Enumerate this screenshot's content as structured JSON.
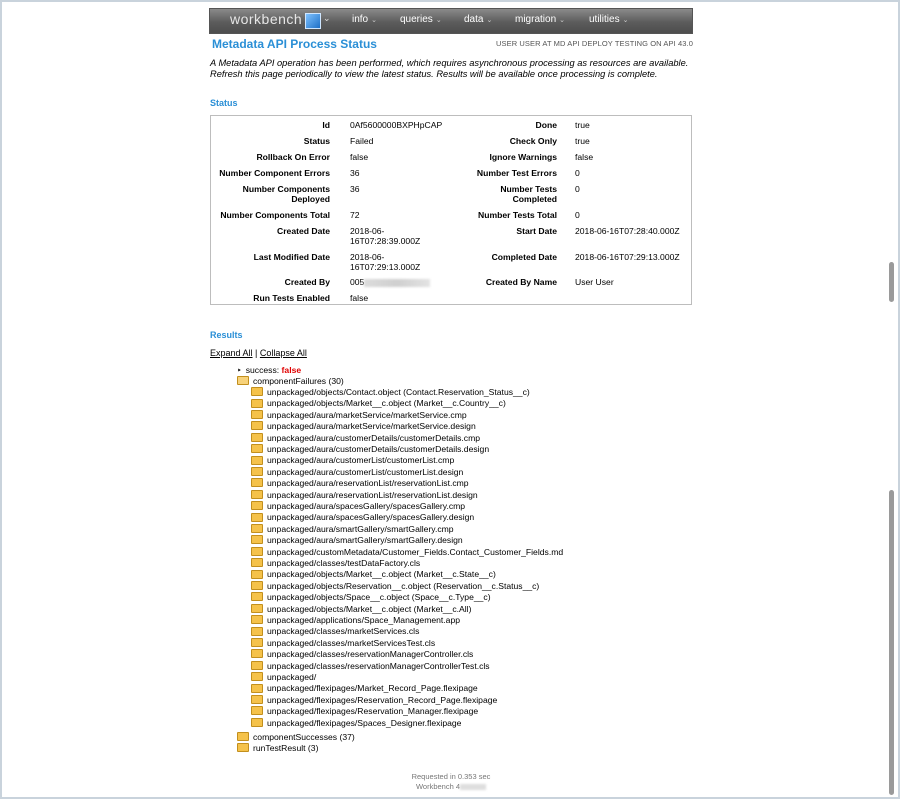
{
  "nav": {
    "brand": "workbench",
    "items": [
      {
        "label": "info"
      },
      {
        "label": "queries"
      },
      {
        "label": "data"
      },
      {
        "label": "migration"
      },
      {
        "label": "utilities"
      }
    ]
  },
  "header": {
    "title": "Metadata API Process Status",
    "user_info": "USER USER AT MD API DEPLOY TESTING ON API 43.0"
  },
  "intro": "A Metadata API operation has been performed, which requires asynchronous processing as resources are available. Refresh this page periodically to view the latest status. Results will be available once processing is complete.",
  "status": {
    "heading": "Status",
    "left": [
      {
        "label": "Id",
        "value": "0Af5600000BXPHpCAP"
      },
      {
        "label": "Status",
        "value": "Failed"
      },
      {
        "label": "Rollback On Error",
        "value": "false"
      },
      {
        "label": "Number Component Errors",
        "value": "36"
      },
      {
        "label": "Number Components Deployed",
        "value": "36"
      },
      {
        "label": "Number Components Total",
        "value": "72"
      },
      {
        "label": "Created Date",
        "value": "2018-06-16T07:28:39.000Z"
      },
      {
        "label": "Last Modified Date",
        "value": "2018-06-16T07:29:13.000Z"
      },
      {
        "label": "Created By",
        "value": "005"
      },
      {
        "label": "Run Tests Enabled",
        "value": "false"
      }
    ],
    "right": [
      {
        "label": "Done",
        "value": "true"
      },
      {
        "label": "Check Only",
        "value": "true"
      },
      {
        "label": "Ignore Warnings",
        "value": "false"
      },
      {
        "label": "Number Test Errors",
        "value": "0"
      },
      {
        "label": "Number Tests Completed",
        "value": "0"
      },
      {
        "label": "Number Tests Total",
        "value": "0"
      },
      {
        "label": "Start Date",
        "value": "2018-06-16T07:28:40.000Z"
      },
      {
        "label": "Completed Date",
        "value": "2018-06-16T07:29:13.000Z"
      },
      {
        "label": "Created By Name",
        "value": "User User"
      }
    ]
  },
  "results": {
    "heading": "Results",
    "expand_all": "Expand All",
    "separator": "|",
    "collapse_all": "Collapse All",
    "success_label": "success:",
    "success_value": "false",
    "component_failures": "componentFailures (30)",
    "failures": [
      "unpackaged/objects/Contact.object (Contact.Reservation_Status__c)",
      "unpackaged/objects/Market__c.object (Market__c.Country__c)",
      "unpackaged/aura/marketService/marketService.cmp",
      "unpackaged/aura/marketService/marketService.design",
      "unpackaged/aura/customerDetails/customerDetails.cmp",
      "unpackaged/aura/customerDetails/customerDetails.design",
      "unpackaged/aura/customerList/customerList.cmp",
      "unpackaged/aura/customerList/customerList.design",
      "unpackaged/aura/reservationList/reservationList.cmp",
      "unpackaged/aura/reservationList/reservationList.design",
      "unpackaged/aura/spacesGallery/spacesGallery.cmp",
      "unpackaged/aura/spacesGallery/spacesGallery.design",
      "unpackaged/aura/smartGallery/smartGallery.cmp",
      "unpackaged/aura/smartGallery/smartGallery.design",
      "unpackaged/customMetadata/Customer_Fields.Contact_Customer_Fields.md",
      "unpackaged/classes/testDataFactory.cls",
      "unpackaged/objects/Market__c.object (Market__c.State__c)",
      "unpackaged/objects/Reservation__c.object (Reservation__c.Status__c)",
      "unpackaged/objects/Space__c.object (Space__c.Type__c)",
      "unpackaged/objects/Market__c.object (Market__c.All)",
      "unpackaged/applications/Space_Management.app",
      "unpackaged/classes/marketServices.cls",
      "unpackaged/classes/marketServicesTest.cls",
      "unpackaged/classes/reservationManagerController.cls",
      "unpackaged/classes/reservationManagerControllerTest.cls",
      "unpackaged/",
      "unpackaged/flexipages/Market_Record_Page.flexipage",
      "unpackaged/flexipages/Reservation_Record_Page.flexipage",
      "unpackaged/flexipages/Reservation_Manager.flexipage",
      "unpackaged/flexipages/Spaces_Designer.flexipage"
    ],
    "component_successes": "componentSuccesses (37)",
    "run_test_result": "runTestResult (3)"
  },
  "footer": {
    "requested": "Requested in 0.353 sec",
    "workbench": "Workbench 4"
  }
}
